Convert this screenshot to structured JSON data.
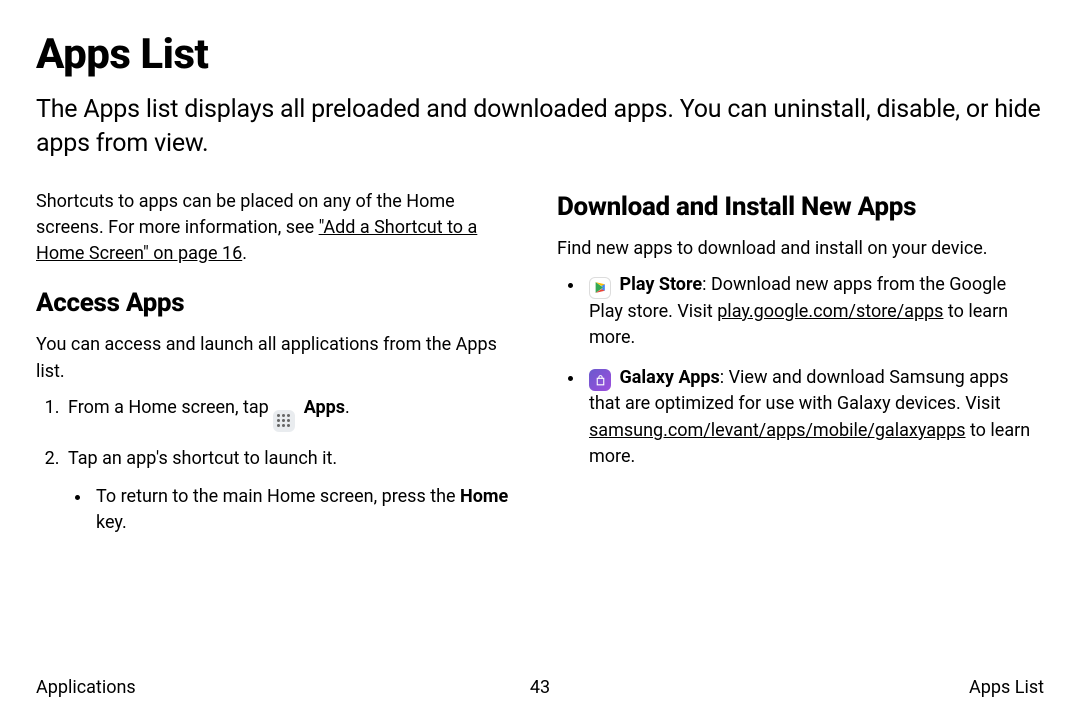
{
  "title": "Apps List",
  "intro": "The Apps list displays all preloaded and downloaded apps. You can uninstall, disable, or hide apps from view.",
  "left": {
    "shortcuts_prefix": "Shortcuts to apps can be placed on any of the Home screens. For more information, see ",
    "shortcuts_link": "\"Add a Shortcut to a Home Screen\" on page 16",
    "shortcuts_suffix": ".",
    "heading": "Access Apps",
    "desc": "You can access and launch all applications from the Apps list.",
    "step1_prefix": "From a Home screen, tap ",
    "step1_bold": "Apps",
    "step1_suffix": ".",
    "step2": "Tap an app's shortcut to launch it.",
    "step2_sub_prefix": "To return to the main Home screen, press the ",
    "step2_sub_bold": "Home",
    "step2_sub_suffix": " key."
  },
  "right": {
    "heading": "Download and Install New Apps",
    "desc": "Find new apps to download and install on your device.",
    "play_bold": "Play Store",
    "play_text1": ": Download new apps from the Google Play store. Visit ",
    "play_link": "play.google.com/store/apps",
    "play_text2": " to learn more.",
    "galaxy_bold": "Galaxy Apps",
    "galaxy_text1": ": View and download Samsung apps that are optimized for use with Galaxy devices. Visit ",
    "galaxy_link": "samsung.com/levant/apps/mobile/galaxyapps",
    "galaxy_text2": " to learn more."
  },
  "footer": {
    "left": "Applications",
    "center": "43",
    "right": "Apps List"
  }
}
